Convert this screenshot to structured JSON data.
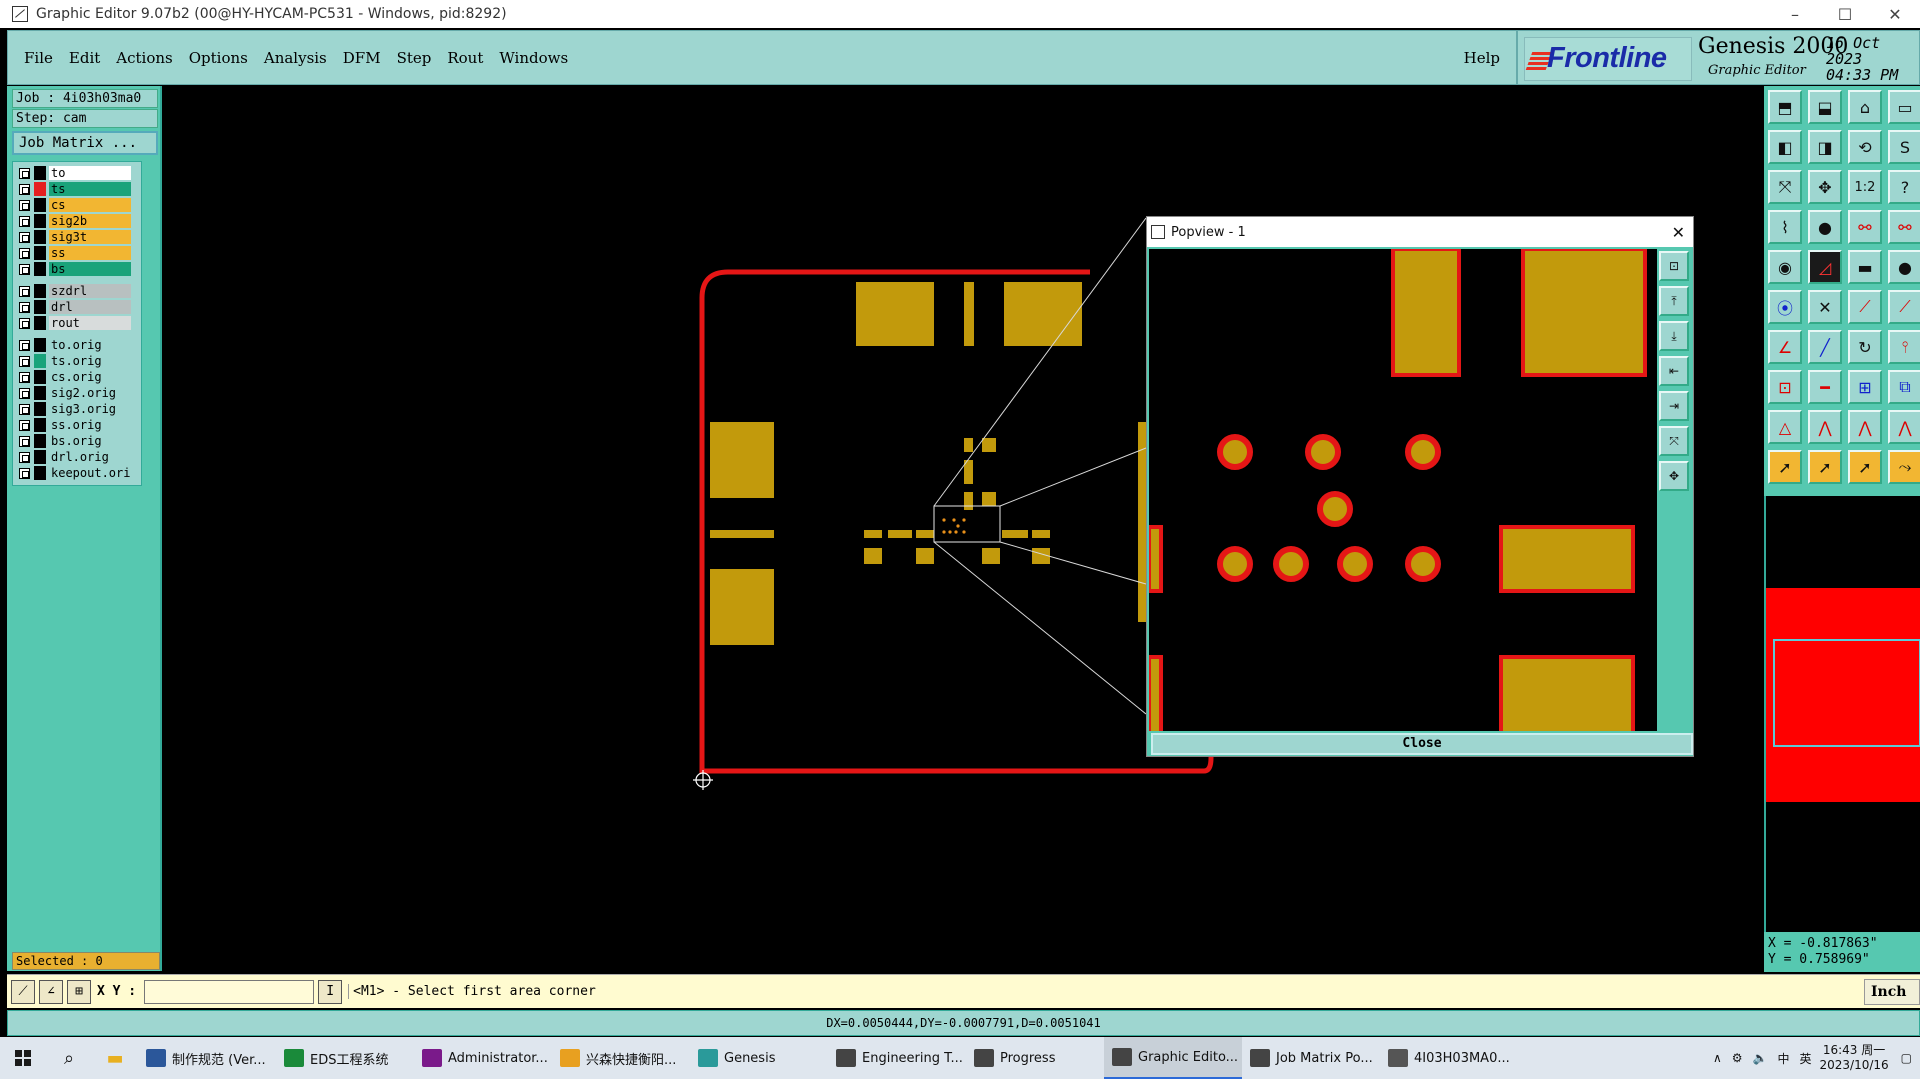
{
  "window": {
    "title": "Graphic Editor 9.07b2 (00@HY-HYCAM-PC531 - Windows, pid:8292)"
  },
  "menu": {
    "items": [
      "File",
      "Edit",
      "Actions",
      "Options",
      "Analysis",
      "DFM",
      "Step",
      "Rout",
      "Windows"
    ],
    "help": "Help"
  },
  "brand": {
    "logo": "Frontline",
    "product": "Genesis 2000",
    "subtitle": "Graphic Editor",
    "date": "16 Oct 2023",
    "time": "04:33 PM"
  },
  "job": {
    "job_line": "Job : 4i03h03ma0",
    "step_line": "Step: cam",
    "matrix_button": "Job Matrix ..."
  },
  "layers": [
    {
      "name": "to",
      "color": "#ffffff",
      "marker": "#000000"
    },
    {
      "name": "ts",
      "color": "#1aa37a",
      "marker": "#e52020"
    },
    {
      "name": "cs",
      "color": "#f2b632",
      "marker": "#000000"
    },
    {
      "name": "sig2b",
      "color": "#f2b632",
      "marker": "#000000"
    },
    {
      "name": "sig3t",
      "color": "#f2b632",
      "marker": "#000000"
    },
    {
      "name": "ss",
      "color": "#f2b632",
      "marker": "#000000"
    },
    {
      "name": "bs",
      "color": "#1aa37a",
      "marker": "#000000"
    },
    {
      "name": "szdrl",
      "color": "#b8c0c0",
      "marker": "#000000"
    },
    {
      "name": "drl",
      "color": "#b8c0c0",
      "marker": "#000000"
    },
    {
      "name": "rout",
      "color": "#d8dcdc",
      "marker": "#000000"
    },
    {
      "name": "to.orig",
      "color": "#9ed6d0",
      "marker": "#000000"
    },
    {
      "name": "ts.orig",
      "color": "#9ed6d0",
      "marker": "#1aa37a"
    },
    {
      "name": "cs.orig",
      "color": "#9ed6d0",
      "marker": "#000000"
    },
    {
      "name": "sig2.orig",
      "color": "#9ed6d0",
      "marker": "#000000"
    },
    {
      "name": "sig3.orig",
      "color": "#9ed6d0",
      "marker": "#000000"
    },
    {
      "name": "ss.orig",
      "color": "#9ed6d0",
      "marker": "#000000"
    },
    {
      "name": "bs.orig",
      "color": "#9ed6d0",
      "marker": "#000000"
    },
    {
      "name": "drl.orig",
      "color": "#9ed6d0",
      "marker": "#000000"
    },
    {
      "name": "keepout.orig",
      "color": "#9ed6d0",
      "marker": "#000000"
    }
  ],
  "status": {
    "selected": "Selected : 0"
  },
  "popview": {
    "title": "Popview - 1",
    "close_label": "Close"
  },
  "cursor": {
    "x_line": "X = -0.817863\"",
    "y_line": "Y = 0.758969\""
  },
  "command": {
    "xy_label": "X Y :",
    "xy_value": "",
    "message": "<M1> - Select first area corner",
    "units": "Inch"
  },
  "measure": "DX=0.0050444,DY=-0.0007791,D=0.0051041",
  "taskbar": {
    "items": [
      {
        "label": "制作规范 (Ver...",
        "icon_color": "#2b579a"
      },
      {
        "label": "EDS工程系统",
        "icon_color": "#1a8a3a"
      },
      {
        "label": "Administrator...",
        "icon_color": "#7a1a8a"
      },
      {
        "label": "兴森快捷衡阳...",
        "icon_color": "#e8a020"
      },
      {
        "label": "Genesis",
        "icon_color": "#2a9a9a"
      },
      {
        "label": "Engineering T...",
        "icon_color": "#444444"
      },
      {
        "label": "Progress",
        "icon_color": "#444444"
      },
      {
        "label": "Graphic Edito...",
        "icon_color": "#444444"
      },
      {
        "label": "Job Matrix Po...",
        "icon_color": "#444444"
      },
      {
        "label": "4I03H03MA0...",
        "icon_color": "#555555"
      }
    ],
    "active_index": 7,
    "ime": "中",
    "lang": "英",
    "clock_time": "16:43 周一",
    "clock_date": "2023/10/16"
  },
  "colors": {
    "panel": "#56c8b0",
    "panel_light": "#9ed6d0",
    "copper": "#c29a0c",
    "outline_red": "#e51616"
  }
}
